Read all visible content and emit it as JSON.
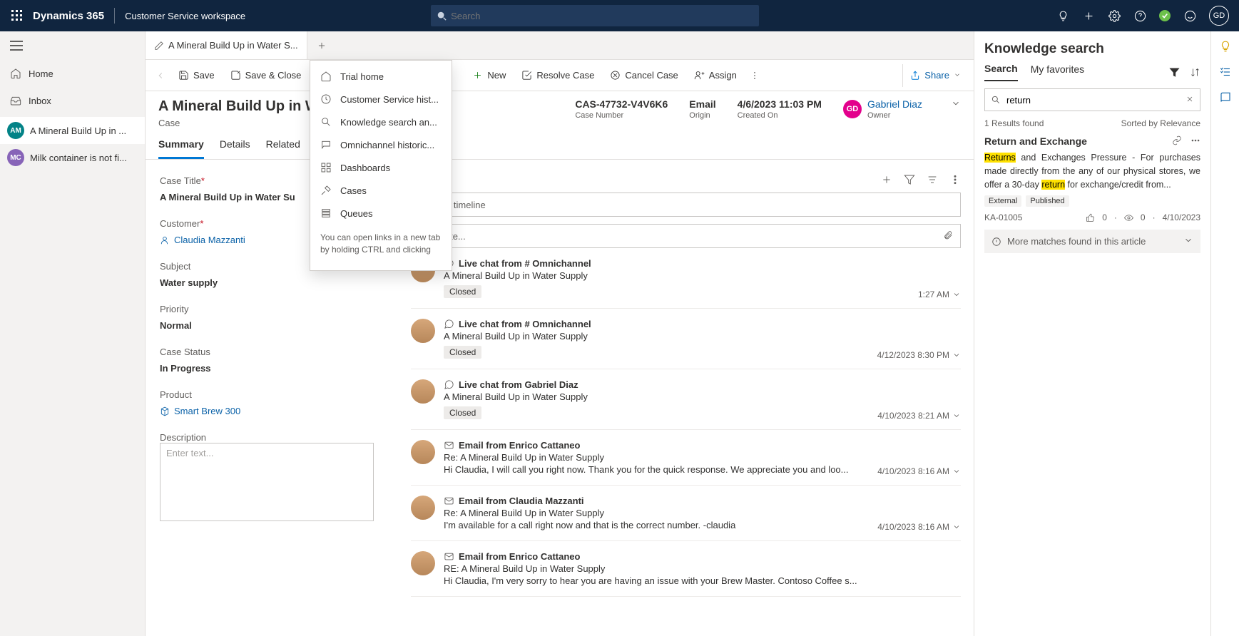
{
  "header": {
    "brand": "Dynamics 365",
    "workspace": "Customer Service workspace",
    "search_placeholder": "Search",
    "avatar_initials": "GD"
  },
  "nav": {
    "home": "Home",
    "inbox": "Inbox",
    "sessions": [
      {
        "badge": "AM",
        "label": "A Mineral Build Up in ...",
        "active": true
      },
      {
        "badge": "MC",
        "label": "Milk container is not fi..."
      }
    ]
  },
  "tabs": {
    "current": "A Mineral Build Up in Water S..."
  },
  "nt_menu": {
    "items": [
      "Trial home",
      "Customer Service hist...",
      "Knowledge search an...",
      "Omnichannel historic...",
      "Dashboards",
      "Cases",
      "Queues"
    ],
    "hint": "You can open links in a new tab by holding CTRL and clicking"
  },
  "commands": {
    "save": "Save",
    "save_close": "Save & Close",
    "new": "New",
    "resolve": "Resolve Case",
    "cancel": "Cancel Case",
    "assign": "Assign",
    "share": "Share"
  },
  "rec": {
    "title": "A Mineral Build Up in W...",
    "subtitle": "Case",
    "case_number": {
      "val": "CAS-47732-V4V6K6",
      "lbl": "Case Number"
    },
    "origin": {
      "val": "Email",
      "lbl": "Origin"
    },
    "created": {
      "val": "4/6/2023 11:03 PM",
      "lbl": "Created On"
    },
    "owner": {
      "initials": "GD",
      "name": "Gabriel Diaz",
      "lbl": "Owner"
    }
  },
  "pivot": [
    "Summary",
    "Details",
    "Related"
  ],
  "fields": {
    "case_title_lbl": "Case Title",
    "case_title_val": "A Mineral Build Up in Water Su",
    "customer_lbl": "Customer",
    "customer_val": "Claudia Mazzanti",
    "subject_lbl": "Subject",
    "subject_val": "Water supply",
    "priority_lbl": "Priority",
    "priority_val": "Normal",
    "status_lbl": "Case Status",
    "status_val": "In Progress",
    "product_lbl": "Product",
    "product_val": "Smart Brew 300",
    "desc_lbl": "Description",
    "desc_ph": "Enter text..."
  },
  "tl": {
    "label": "e",
    "search_ph": "arch timeline",
    "note_ph": "ter a note...",
    "items": [
      {
        "type": "chat",
        "title": "Live chat from # Omnichannel",
        "sub": "A Mineral Build Up in Water Supply",
        "badge": "Closed",
        "time": "1:27 AM"
      },
      {
        "type": "chat",
        "title": "Live chat from # Omnichannel",
        "sub": "A Mineral Build Up in Water Supply",
        "badge": "Closed",
        "time": "4/12/2023 8:30 PM"
      },
      {
        "type": "chat",
        "title": "Live chat from Gabriel Diaz",
        "sub": "A Mineral Build Up in Water Supply",
        "badge": "Closed",
        "time": "4/10/2023 8:21 AM"
      },
      {
        "type": "email",
        "title": "Email from Enrico Cattaneo",
        "sub": "Re: A Mineral Build Up in Water Supply",
        "desc": "Hi Claudia, I will call you right now. Thank you for the quick response. We appreciate you and loo...",
        "time": "4/10/2023 8:16 AM"
      },
      {
        "type": "email",
        "title": "Email from Claudia Mazzanti",
        "sub": "Re: A Mineral Build Up in Water Supply",
        "desc": "I'm available for a call right now and that is the correct number. -claudia",
        "time": "4/10/2023 8:16 AM"
      },
      {
        "type": "email",
        "title": "Email from Enrico Cattaneo",
        "sub": "RE: A Mineral Build Up in Water Supply",
        "desc": "Hi Claudia, I'm very sorry to hear you are having an issue with your Brew Master. Contoso Coffee s...",
        "time": ""
      }
    ]
  },
  "ks": {
    "title": "Knowledge search",
    "tabs": {
      "search": "Search",
      "fav": "My favorites"
    },
    "query": "return",
    "results_text": "1 Results found",
    "sort_text": "Sorted by Relevance",
    "result_title": "Return and Exchange",
    "snippet_parts": [
      "Returns",
      " and Exchanges Pressure - For purchases made directly from the any of our physical stores, we offer a 30-day ",
      "return",
      " for exchange/credit from..."
    ],
    "tags": [
      "External",
      "Published"
    ],
    "id": "KA-01005",
    "likes": "0",
    "views": "0",
    "date": "4/10/2023",
    "more": "More matches found in this article"
  }
}
